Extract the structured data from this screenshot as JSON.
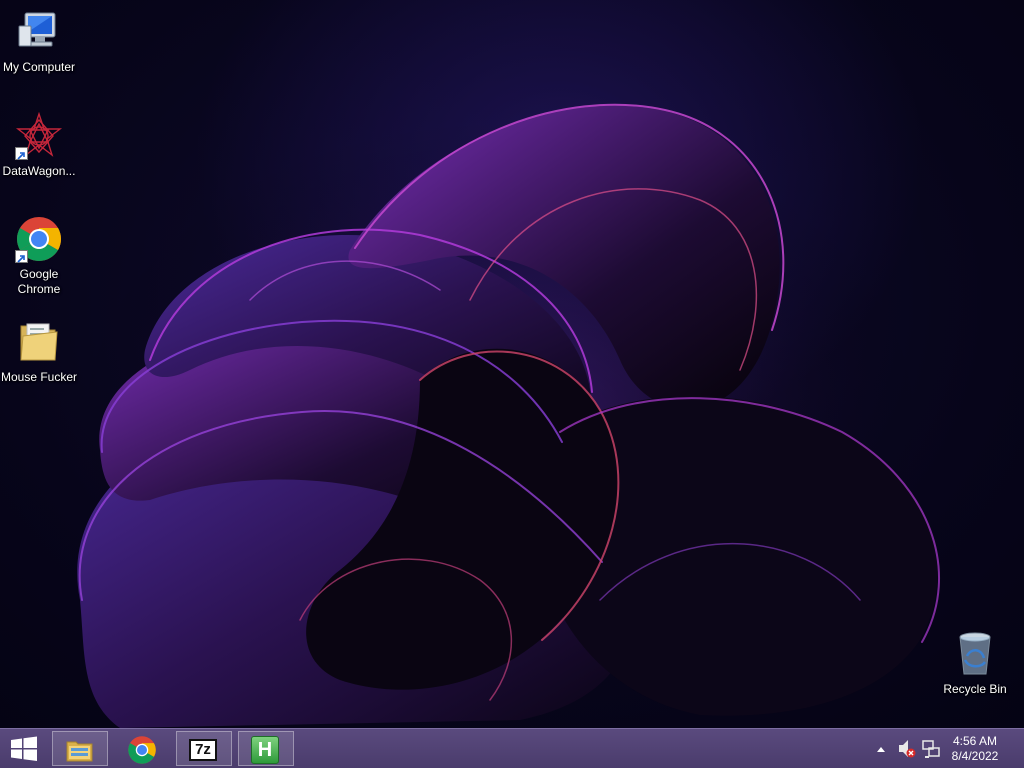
{
  "desktop": {
    "icons": [
      {
        "label": "My Computer",
        "icon": "computer-icon"
      },
      {
        "label": "DataWagon...",
        "icon": "datawagon-icon"
      },
      {
        "label": "Google Chrome",
        "icon": "chrome-icon"
      },
      {
        "label": "Mouse Fucker",
        "icon": "folder-icon"
      },
      {
        "label": "Recycle Bin",
        "icon": "recycle-bin-icon"
      }
    ]
  },
  "taskbar": {
    "start": {
      "icon": "windows-logo-icon"
    },
    "pinned": [
      {
        "name": "file-explorer",
        "icon": "file-explorer-icon"
      },
      {
        "name": "google-chrome",
        "icon": "chrome-icon"
      },
      {
        "name": "7-zip",
        "icon": "7zip-icon",
        "text": "7z"
      },
      {
        "name": "hotkey-app",
        "icon": "h-app-icon",
        "text": "H"
      }
    ],
    "tray": {
      "icons": [
        "show-hidden-icons-chevron-icon",
        "volume-muted-icon",
        "network-icon"
      ],
      "time": "4:56 AM",
      "date": "8/4/2022"
    }
  },
  "colors": {
    "taskbar": "#4f4172",
    "wallpaper_accent": "#a03ad8",
    "chrome_red": "#db4437",
    "chrome_green": "#0f9d58",
    "chrome_yellow": "#f4b400",
    "chrome_blue": "#4285f4"
  }
}
